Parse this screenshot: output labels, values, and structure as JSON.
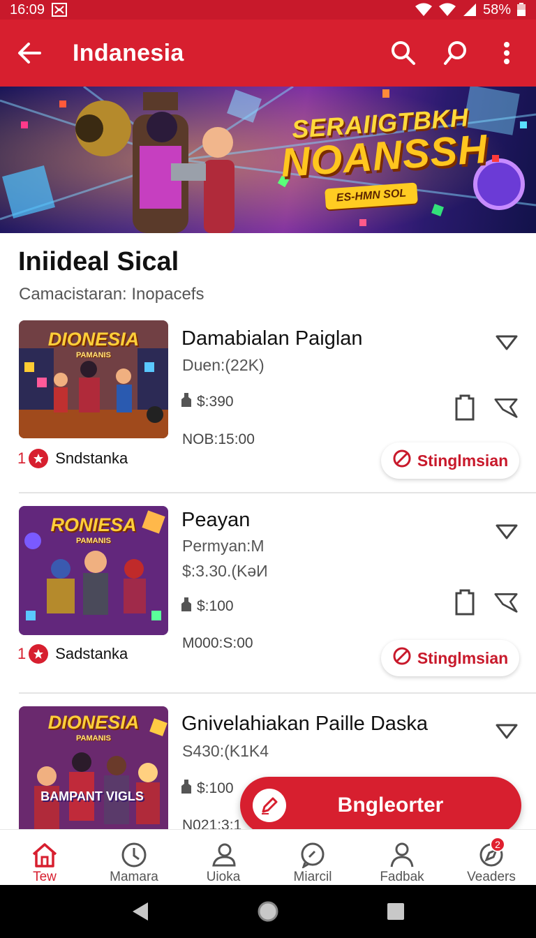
{
  "status_bar": {
    "time": "16:09",
    "battery": "58%"
  },
  "app_bar": {
    "title": "Indanesia",
    "icons": [
      "back-arrow-icon",
      "search-icon",
      "search-alt-icon",
      "more-vert-icon"
    ]
  },
  "banner": {
    "line1": "SERAIIGTBKH",
    "line2": "NOANSSH",
    "pill": "ES-HMN SOL"
  },
  "section": {
    "title": "Iniideal Sical",
    "subtitle": "Camacistaran: Inopacefs"
  },
  "cards": [
    {
      "thumb_title": "DIONESIA",
      "thumb_sub": "PAMANIS",
      "rank_num": "1",
      "rank_label": "Sndstanka",
      "title": "Damabialan Paiglan",
      "line1": "Duen:(22K)",
      "line2": "",
      "price": "$:390",
      "time": "NOB:15:00",
      "action": "Stinglmsian"
    },
    {
      "thumb_title": "RONIESA",
      "thumb_sub": "PAMANIS",
      "rank_num": "1",
      "rank_label": "Sadstanka",
      "title": "Peayan",
      "line1": "Permyan:M",
      "line2": "$:3.30.(KəИ",
      "price": "$:100",
      "time": "M000:S:00",
      "action": "Stinglmsian"
    },
    {
      "thumb_title": "DIONESIA",
      "thumb_sub": "PAMANIS",
      "thumb_extra": "BAMPANT VIGLS",
      "title": "Gnivelahiakan Paille Daska",
      "line1": "S430:(K1K4",
      "price": "$:100",
      "time": "N021:3:1"
    }
  ],
  "fab": {
    "label": "Bngleorter"
  },
  "bottom_nav": [
    {
      "label": "Tew",
      "icon": "home-icon",
      "active": true
    },
    {
      "label": "Mamara",
      "icon": "clock-icon",
      "active": false
    },
    {
      "label": "Uioka",
      "icon": "people-icon",
      "active": false
    },
    {
      "label": "Miarcil",
      "icon": "chat-icon",
      "active": false
    },
    {
      "label": "Fadbak",
      "icon": "person-icon",
      "active": false
    },
    {
      "label": "Veaders",
      "icon": "compass-icon",
      "active": false,
      "badge": "2"
    }
  ],
  "colors": {
    "primary": "#d71f2f",
    "status": "#c8192b"
  }
}
